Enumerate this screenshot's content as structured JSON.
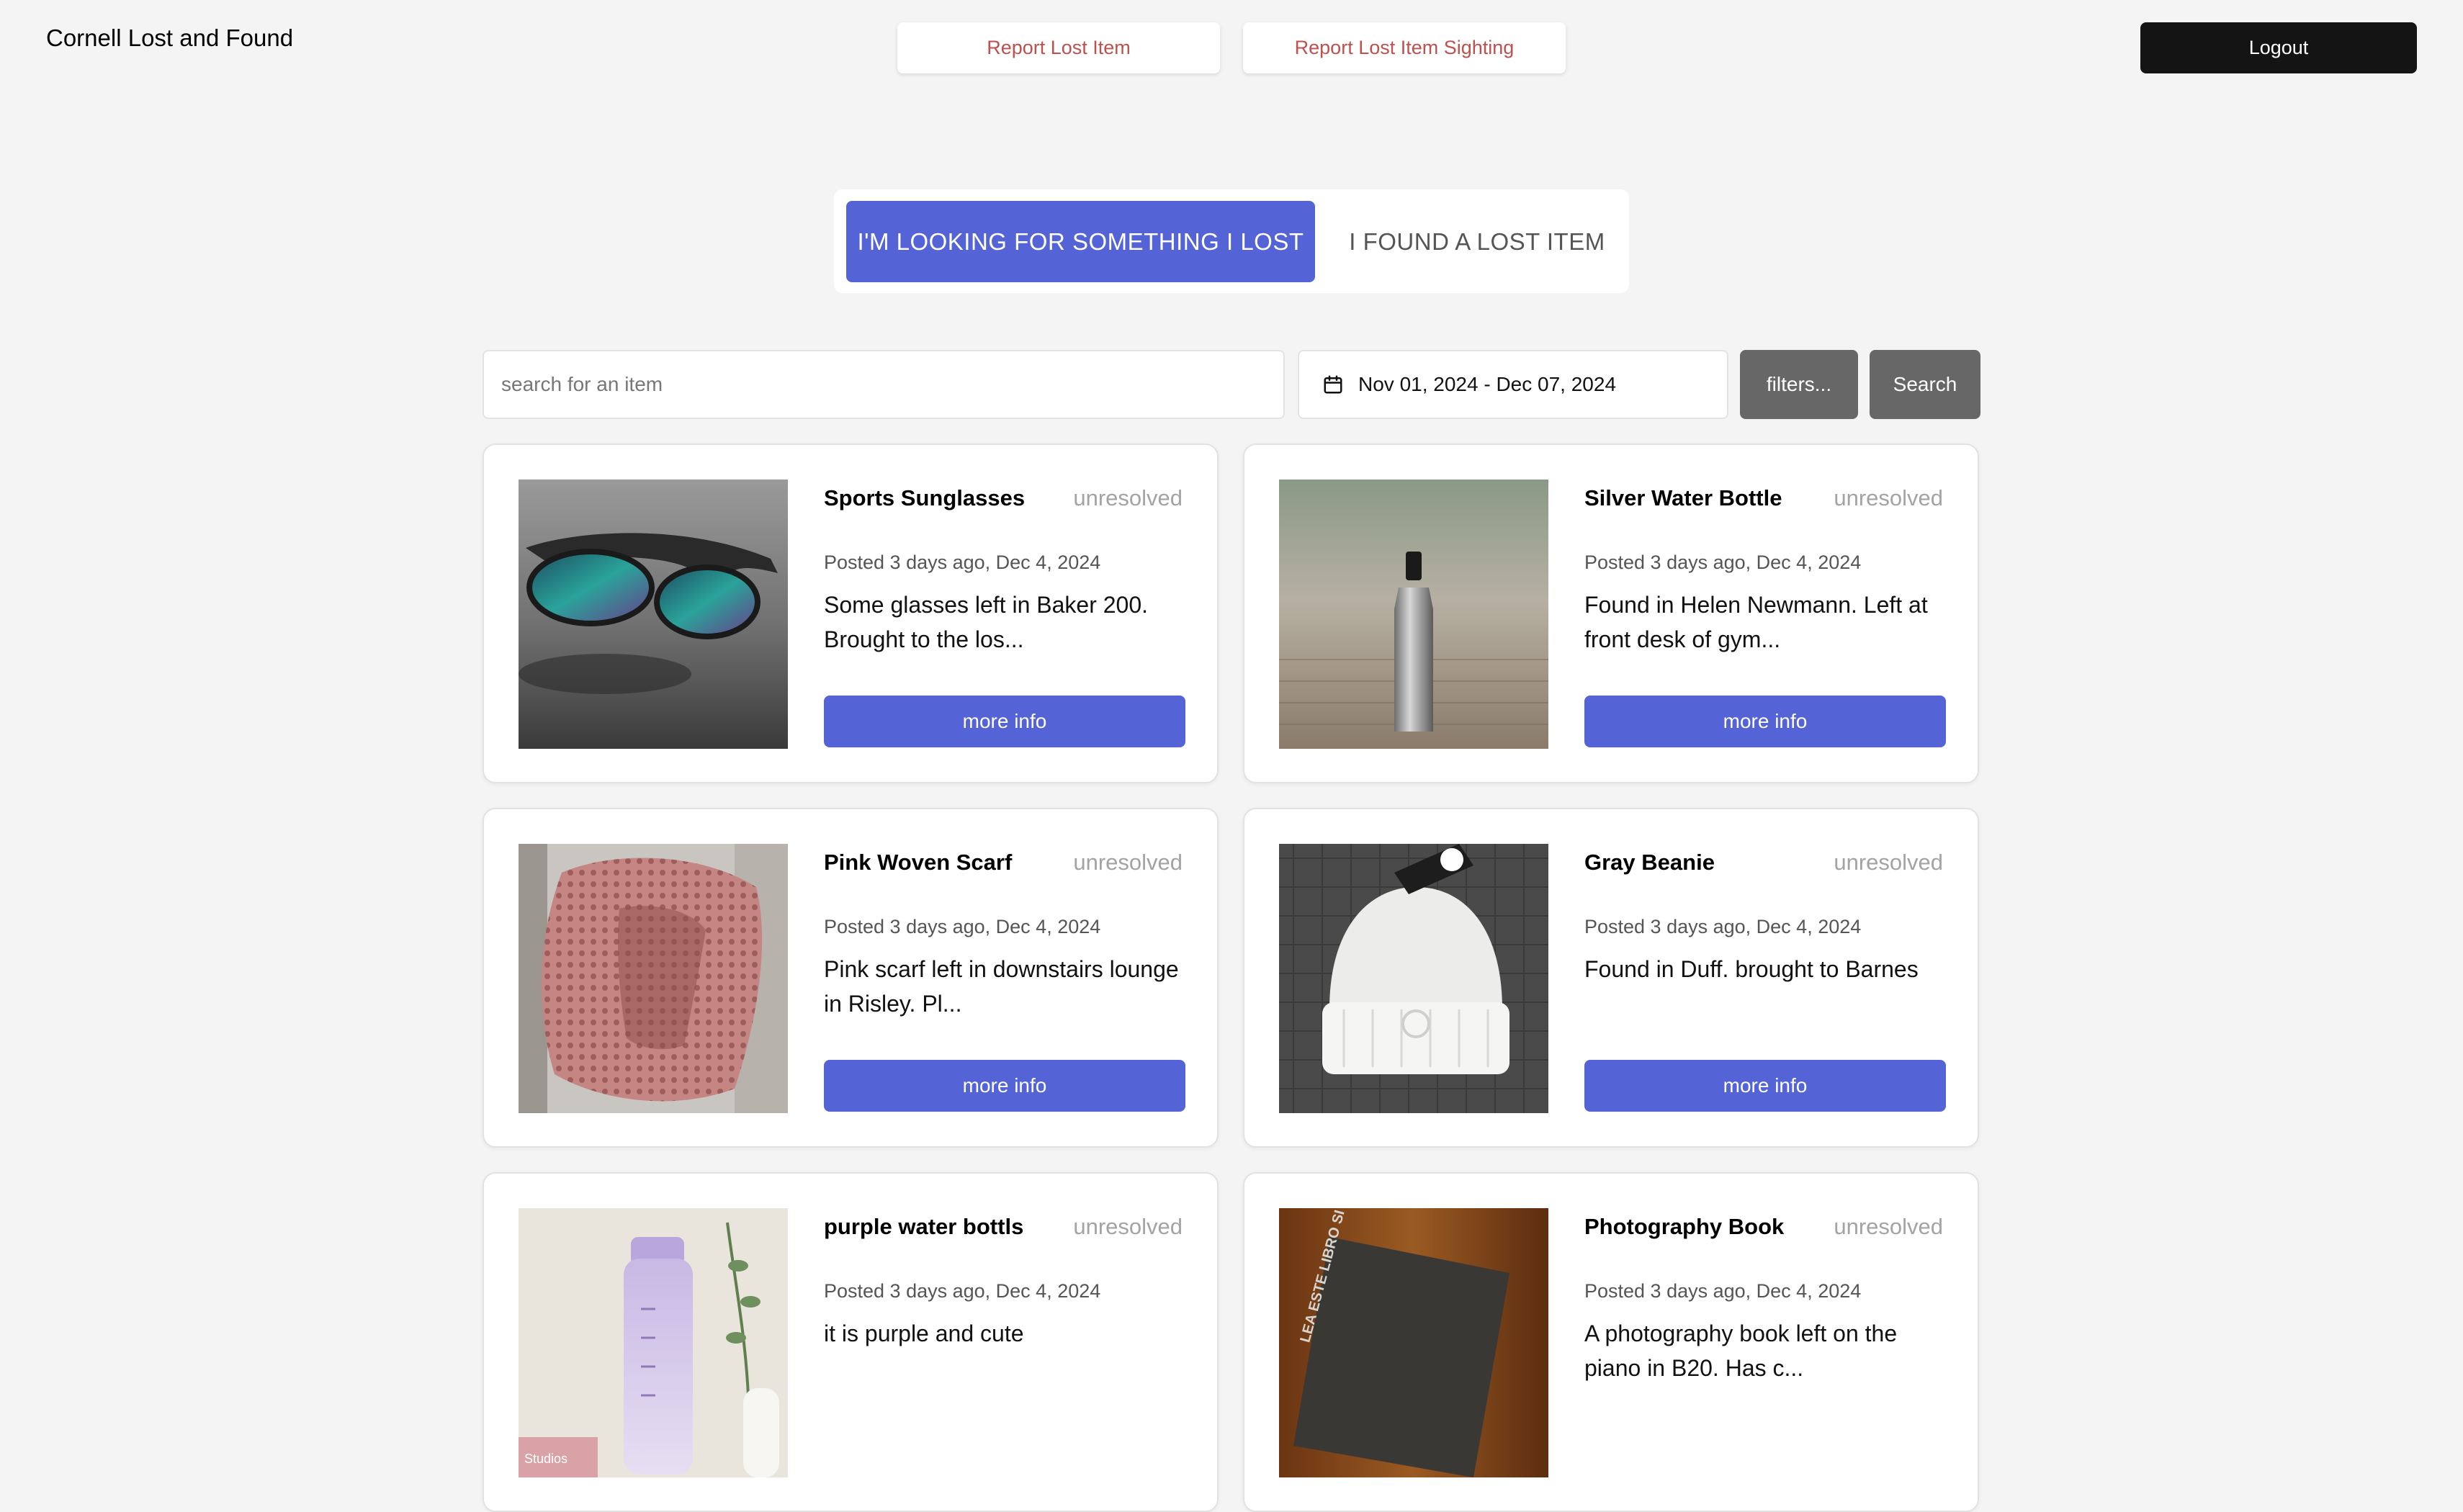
{
  "header": {
    "brand": "Cornell Lost and Found",
    "report_lost_label": "Report Lost Item",
    "report_sighting_label": "Report Lost Item Sighting",
    "logout_label": "Logout"
  },
  "mode_toggle": {
    "looking_label": "I'M LOOKING FOR SOMETHING I LOST",
    "found_label": "I FOUND A LOST ITEM",
    "active": "looking"
  },
  "search": {
    "placeholder": "search for an item",
    "value": "",
    "date_range": "Nov 01, 2024 - Dec 07, 2024",
    "filters_label": "filters...",
    "search_label": "Search"
  },
  "items": [
    {
      "title": "Sports Sunglasses",
      "status": "unresolved",
      "posted": "Posted 3 days ago, Dec 4, 2024",
      "description": "Some glasses left in Baker 200. Brought to the los...",
      "button": "more info",
      "image": "sunglasses"
    },
    {
      "title": "Silver Water Bottle",
      "status": "unresolved",
      "posted": "Posted 3 days ago, Dec 4, 2024",
      "description": "Found in Helen Newmann. Left at front desk of gym...",
      "button": "more info",
      "image": "water-bottle"
    },
    {
      "title": "Pink Woven Scarf",
      "status": "unresolved",
      "posted": "Posted 3 days ago, Dec 4, 2024",
      "description": "Pink scarf left in downstairs lounge in Risley. Pl...",
      "button": "more info",
      "image": "scarf"
    },
    {
      "title": "Gray Beanie",
      "status": "unresolved",
      "posted": "Posted 3 days ago, Dec 4, 2024",
      "description": "Found in Duff. brought to Barnes",
      "button": "more info",
      "image": "beanie"
    },
    {
      "title": "purple water bottls",
      "status": "unresolved",
      "posted": "Posted 3 days ago, Dec 4, 2024",
      "description": "it is purple and cute",
      "button": "more info",
      "image": "purple-bottle",
      "image_text": "Studios"
    },
    {
      "title": "Photography Book",
      "status": "unresolved",
      "posted": "Posted 3 days ago, Dec 4, 2024",
      "description": "A photography book left on the piano in B20. Has c...",
      "button": "more info",
      "image": "photo-book",
      "image_text": "LEA ESTE LIBRO SI DESEA TOMAR BUENAS FOTOGRAFIAS"
    }
  ],
  "colors": {
    "accent": "#5463d6",
    "background": "#f4f4f4",
    "logout": "#141414",
    "report_text": "#c0504d",
    "status_text": "#a3a3a3",
    "gray_button": "#676767"
  }
}
